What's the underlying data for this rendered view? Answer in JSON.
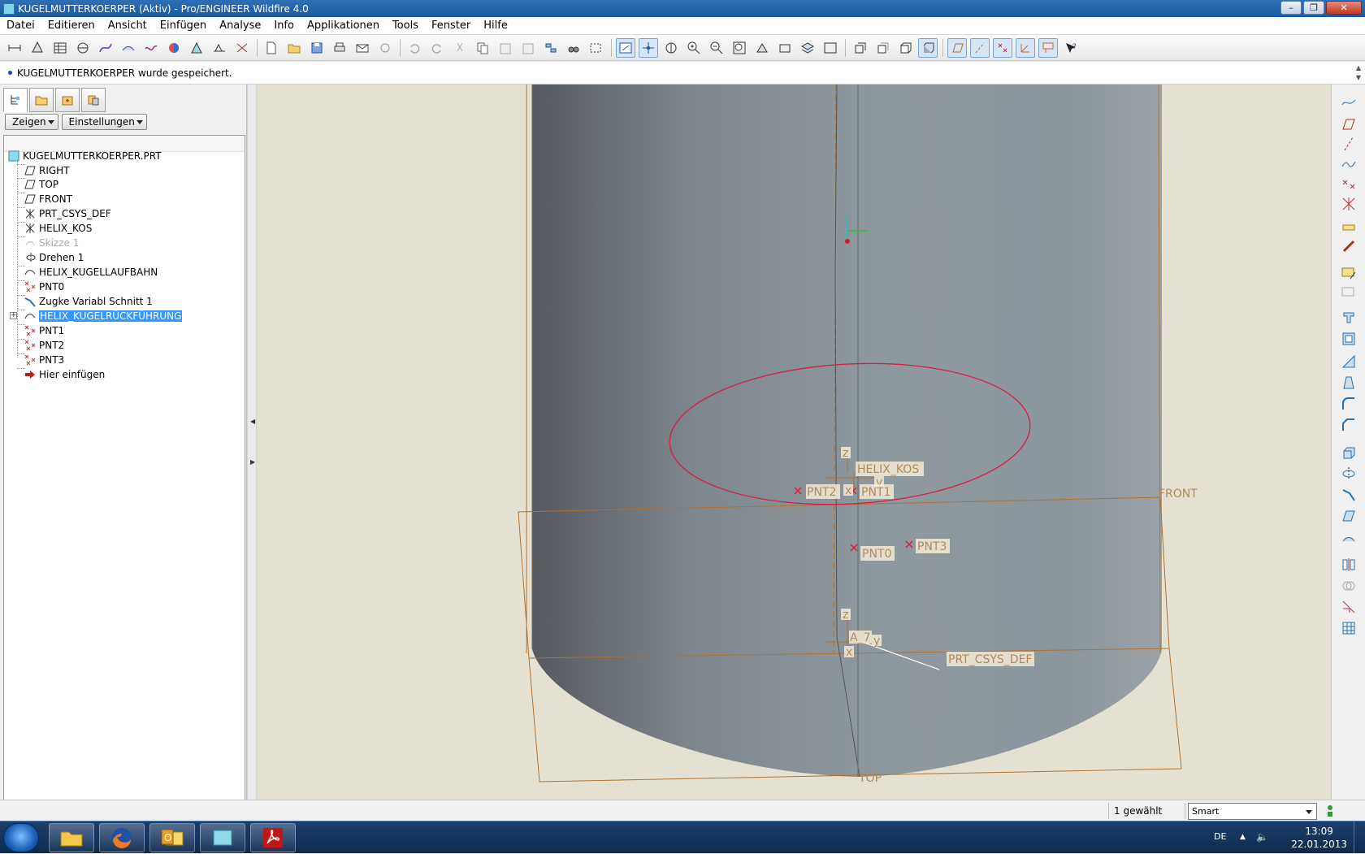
{
  "window": {
    "title": "KUGELMUTTERKOERPER (Aktiv) - Pro/ENGINEER Wildfire 4.0",
    "buttons": [
      "–",
      "❐",
      "✕"
    ]
  },
  "menu": [
    "Datei",
    "Editieren",
    "Ansicht",
    "Einfügen",
    "Analyse",
    "Info",
    "Applikationen",
    "Tools",
    "Fenster",
    "Hilfe"
  ],
  "message": "KUGELMUTTERKOERPER wurde gespeichert.",
  "panel": {
    "show_button": "Zeigen",
    "settings_button": "Einstellungen",
    "tree": [
      {
        "label": "KUGELMUTTERKOERPER.PRT",
        "icon": "part-icon",
        "state": "normal"
      },
      {
        "label": "RIGHT",
        "icon": "datum-plane-icon",
        "state": "normal"
      },
      {
        "label": "TOP",
        "icon": "datum-plane-icon",
        "state": "normal"
      },
      {
        "label": "FRONT",
        "icon": "datum-plane-icon",
        "state": "normal"
      },
      {
        "label": "PRT_CSYS_DEF",
        "icon": "csys-icon",
        "state": "normal"
      },
      {
        "label": "HELIX_KOS",
        "icon": "csys-icon",
        "state": "normal"
      },
      {
        "label": "Skizze 1",
        "icon": "sketch-icon",
        "state": "suppressed"
      },
      {
        "label": "Drehen 1",
        "icon": "revolve-icon",
        "state": "normal"
      },
      {
        "label": "HELIX_KUGELLAUFBAHN",
        "icon": "curve-icon",
        "state": "normal"
      },
      {
        "label": "PNT0",
        "icon": "datum-point-icon",
        "state": "normal"
      },
      {
        "label": "Zugke Variabl Schnitt 1",
        "icon": "sweep-icon",
        "state": "normal"
      },
      {
        "label": "HELIX_KUGELRÜCKFÜHRUNG",
        "icon": "curve-icon",
        "state": "selected"
      },
      {
        "label": "PNT1",
        "icon": "datum-point-icon",
        "state": "normal"
      },
      {
        "label": "PNT2",
        "icon": "datum-point-icon",
        "state": "normal"
      },
      {
        "label": "PNT3",
        "icon": "datum-point-icon",
        "state": "normal"
      },
      {
        "label": "Hier einfügen",
        "icon": "insert-here-icon",
        "state": "normal"
      }
    ]
  },
  "viewport": {
    "labels": {
      "helix_kos": "HELIX_KOS",
      "pnt2": "PNT2",
      "pnt1": "PNT1",
      "pnt0": "PNT0",
      "pnt3": "PNT3",
      "front": "FRONT",
      "top": "TOP",
      "prt_csys_def": "PRT_CSYS_DEF",
      "axis_a": "A_7",
      "z1": "z",
      "y1": "y",
      "x1": "x",
      "z2": "z",
      "y2": "y",
      "x2": "x"
    },
    "colors": {
      "background": "#e4e1d2",
      "body": "#8a949c",
      "datum": "#b07030",
      "curve": "#d81e3c"
    }
  },
  "status": {
    "selection": "1 gewählt",
    "filter": "Smart"
  },
  "taskbar": {
    "apps": [
      "explorer-icon",
      "firefox-icon",
      "outlook-icon",
      "proe-icon",
      "acrobat-icon"
    ],
    "language": "DE",
    "time": "13:09",
    "date": "22.01.2013"
  }
}
